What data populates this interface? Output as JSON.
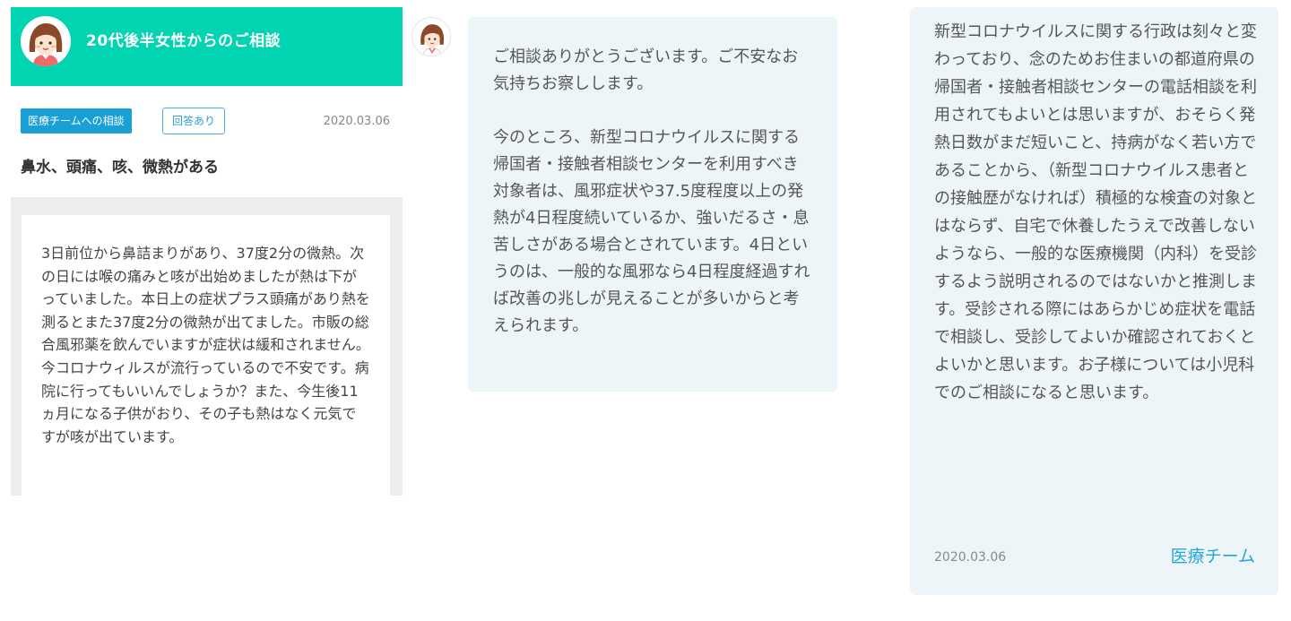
{
  "consultation": {
    "title": "20代後半女性からのご相談",
    "tag": "医療チームへの相談",
    "status": "回答あり",
    "date": "2020.03.06",
    "subject": "鼻水、頭痛、咳、微熱がある",
    "body": "3日前位から鼻詰まりがあり、37度2分の微熱。次の日には喉の痛みと咳が出始めましたが熱は下がっていました。本日上の症状プラス頭痛があり熱を測るとまた37度2分の微熱が出てました。市販の総合風邪薬を飲んでいますが症状は緩和されません。今コロナウィルスが流行っているので不安です。病院に行ってもいいんでしょうか？また、今生後11ヵ月になる子供がおり、その子も熱はなく元気ですが咳が出ています。"
  },
  "reply": {
    "text": "ご相談ありがとうございます。ご不安なお気持ちお察しします。\n\n今のところ、新型コロナウイルスに関する帰国者・接触者相談センターを利用すべき対象者は、風邪症状や37.5度程度以上の発熱が4日程度続いているか、強いだるさ・息苦しさがある場合とされています。4日というのは、一般的な風邪なら4日程度経過すれば改善の兆しが見えることが多いからと考えられます。"
  },
  "reply_continued": {
    "text": "新型コロナウイルスに関する行政は刻々と変わっており、念のためお住まいの都道府県の帰国者・接触者相談センターの電話相談を利用されてもよいとは思いますが、おそらく発熱日数がまだ短いこと、持病がなく若い方であることから、（新型コロナウイルス患者との接触歴がなければ）積極的な検査の対象とはならず、自宅で休養したうえで改善しないようなら、一般的な医療機関（内科）を受診するよう説明されるのではないかと推測します。受診される際にはあらかじめ症状を電話で相談し、受診してよいか確認されておくとよいかと思います。お子様については小児科でのご相談になると思います。",
    "date": "2020.03.06",
    "author": "医療チーム"
  },
  "icons": {
    "avatar": "woman-avatar-icon"
  },
  "colors": {
    "header_bg": "#00d4b1",
    "tag_bg": "#1a9fd6",
    "bubble_bg": "#eef5f9",
    "author_link": "#2aa6d6"
  }
}
